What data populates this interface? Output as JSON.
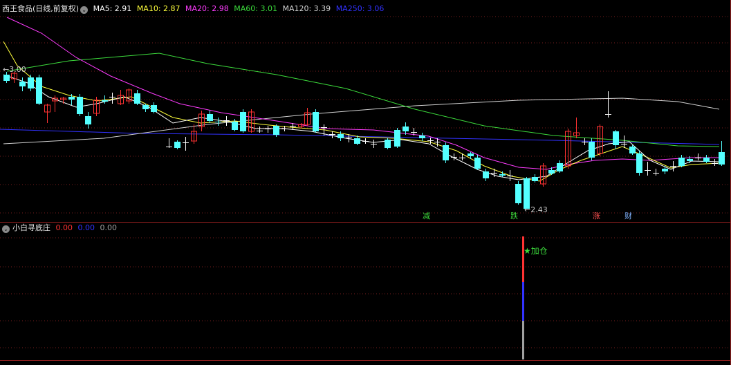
{
  "header": {
    "title": "西王食品(日线,前复权)",
    "ma": [
      {
        "label": "MA5: 2.91",
        "color": "#ffffff"
      },
      {
        "label": "MA10: 2.87",
        "color": "#ffff3c"
      },
      {
        "label": "MA20: 2.98",
        "color": "#ff3cff"
      },
      {
        "label": "MA60: 3.01",
        "color": "#3cdc3c"
      },
      {
        "label": "MA120: 3.39",
        "color": "#d2d2d2"
      },
      {
        "label": "MA250: 3.06",
        "color": "#3232ff"
      }
    ]
  },
  "price_panel": {
    "high_label": "←3.00",
    "low_label": "←2.43",
    "signals": [
      {
        "text": "减",
        "color": "#3cdc3c"
      },
      {
        "text": "跌",
        "color": "#3cdc3c"
      },
      {
        "text": "涨",
        "color": "#ff5050"
      },
      {
        "text": "财",
        "color": "#7fb3ff"
      }
    ]
  },
  "indicator_panel": {
    "name": "小白寻底庄",
    "v1": "0.00",
    "v2": "0.00",
    "v3": "0.00",
    "v1_color": "#ff3232",
    "v2_color": "#3232ff",
    "v3_color": "#a0a0a0",
    "signal_label": "加仓",
    "signal_color": "#3cdc3c"
  },
  "colors": {
    "up": "#ff3232",
    "down": "#54ffff",
    "grid": "#781e1e",
    "separator": "#8c1e1e"
  }
}
